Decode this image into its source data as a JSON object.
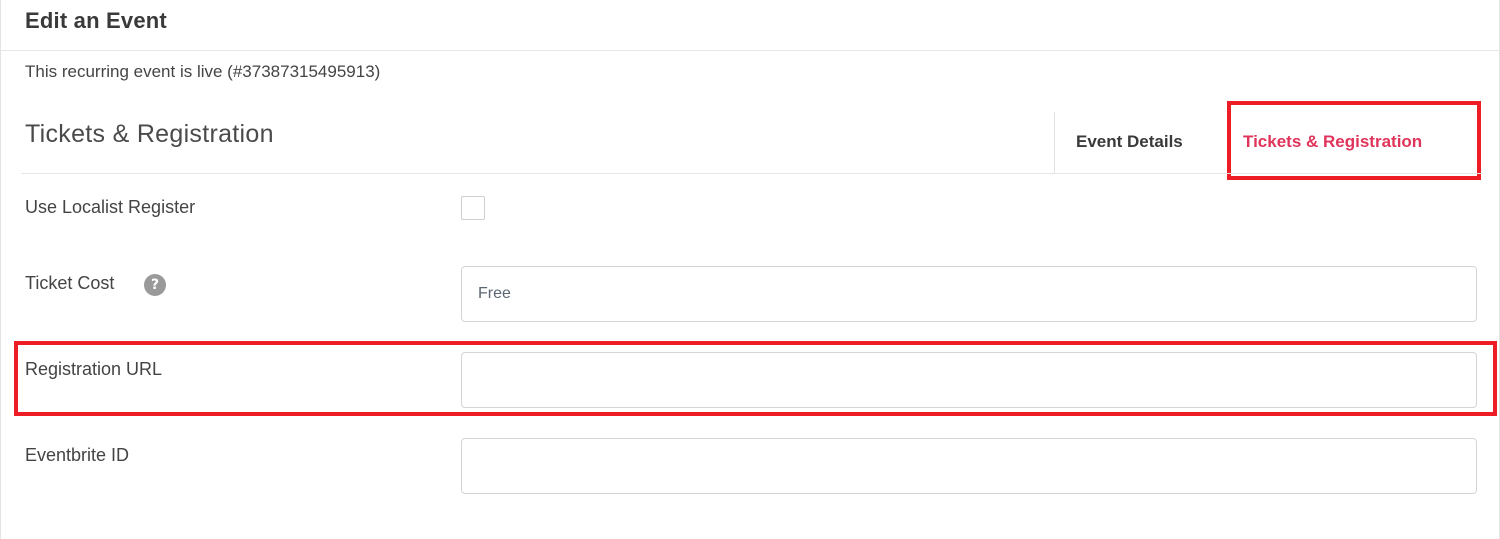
{
  "header": {
    "title": "Edit an Event"
  },
  "status": {
    "text": "This recurring event is live (#37387315495913)"
  },
  "section": {
    "title": "Tickets & Registration"
  },
  "tabs": [
    {
      "label": "Event Details",
      "active": false
    },
    {
      "label": "Tickets & Registration",
      "active": true
    }
  ],
  "form": {
    "use_localist_register": {
      "label": "Use Localist Register",
      "checked": false
    },
    "ticket_cost": {
      "label": "Ticket Cost",
      "help_icon": "question-circle-icon",
      "help_glyph": "?",
      "value": "",
      "placeholder": "Free"
    },
    "registration_url": {
      "label": "Registration URL",
      "value": "",
      "placeholder": ""
    },
    "eventbrite_id": {
      "label": "Eventbrite ID",
      "value": "",
      "placeholder": ""
    }
  },
  "colors": {
    "active_tab": "#e0355a",
    "highlight_box": "#ee1c25",
    "border": "#d4d4d4"
  }
}
